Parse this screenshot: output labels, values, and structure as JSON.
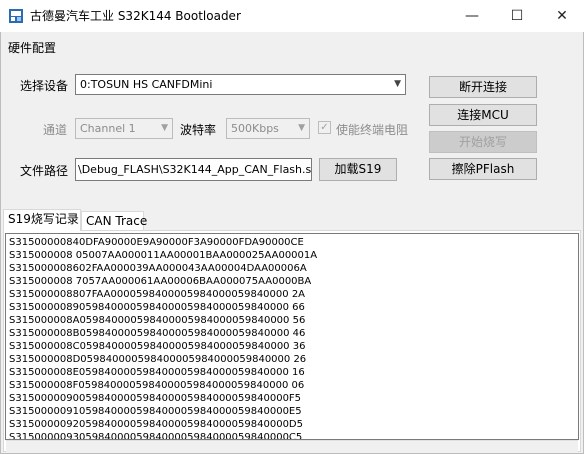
{
  "window": {
    "title": "古德曼汽车工业 S32K144 Bootloader",
    "minimize": "—",
    "maximize": "☐",
    "close": "✕"
  },
  "group": {
    "label": "硬件配置"
  },
  "device": {
    "label": "选择设备",
    "value": "0:TOSUN HS CANFDMini"
  },
  "channel": {
    "label": "通道",
    "value": "Channel 1"
  },
  "baud": {
    "label": "波特率",
    "value": "500Kbps"
  },
  "terminate": {
    "label": "使能终端电阻",
    "checked": true
  },
  "file": {
    "label": "文件路径",
    "value": "\\Debug_FLASH\\S32K144_App_CAN_Flash.srec"
  },
  "buttons": {
    "disconnect": "断开连接",
    "connect_mcu": "连接MCU",
    "start_burn": "开始烧写",
    "load_s19": "加载S19",
    "erase_pflash": "擦除PFlash"
  },
  "tabs": [
    {
      "label": "S19烧写记录"
    },
    {
      "label": "CAN Trace"
    }
  ],
  "log": {
    "lines": [
      "S31500000840DFA90000E9A90000F3A90000FDA90000CE",
      "S315000008 05007AA000011AA00001BAA000025AA00001A",
      "S315000008602FAA000039AA000043AA00004DAA00006A",
      "S315000008 7057AA000061AA00006BAA000075AA0000BA",
      "S315000008807FAA0000598400005984000059840000 2A",
      "S3150000089059840000598400005984000059840000 66",
      "S315000008A059840000598400005984000059840000 56",
      "S315000008B059840000598400005984000059840000 46",
      "S315000008C059840000598400005984000059840000 36",
      "S315000008D059840000598400005984000059840000 26",
      "S315000008E059840000598400005984000059840000 16",
      "S315000008F059840000598400005984000059840000 06",
      "S3150000090059840000598400005984000059840000F5",
      "S3150000091059840000598400005984000059840000E5",
      "S3150000092059840000598400005984000059840000D5",
      "S3150000093059840000598400005984000059840000C5"
    ]
  }
}
